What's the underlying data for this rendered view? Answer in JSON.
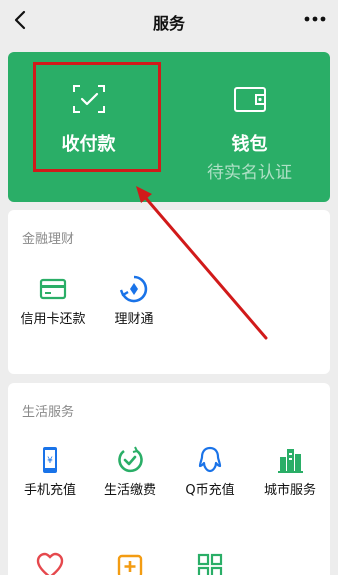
{
  "nav": {
    "title": "服务"
  },
  "top_card": {
    "pay_label": "收付款",
    "wallet_label": "钱包",
    "wallet_status": "待实名认证"
  },
  "finance": {
    "title": "金融理财",
    "items": [
      {
        "label": "信用卡还款",
        "icon": "credit-card-icon"
      },
      {
        "label": "理财通",
        "icon": "wealth-icon"
      }
    ]
  },
  "life": {
    "title": "生活服务",
    "items": [
      {
        "label": "手机充值",
        "icon": "phone-icon"
      },
      {
        "label": "生活缴费",
        "icon": "bill-icon"
      },
      {
        "label": "Q币充值",
        "icon": "qq-icon"
      },
      {
        "label": "城市服务",
        "icon": "city-icon"
      }
    ],
    "partial_icons": [
      "heart-icon",
      "medical-icon",
      "grid-icon"
    ]
  },
  "colors": {
    "green": "#2aae67",
    "annotation_red": "#d11a1a",
    "tile_green": "#2aae67",
    "tile_blue": "#1a73e8"
  }
}
